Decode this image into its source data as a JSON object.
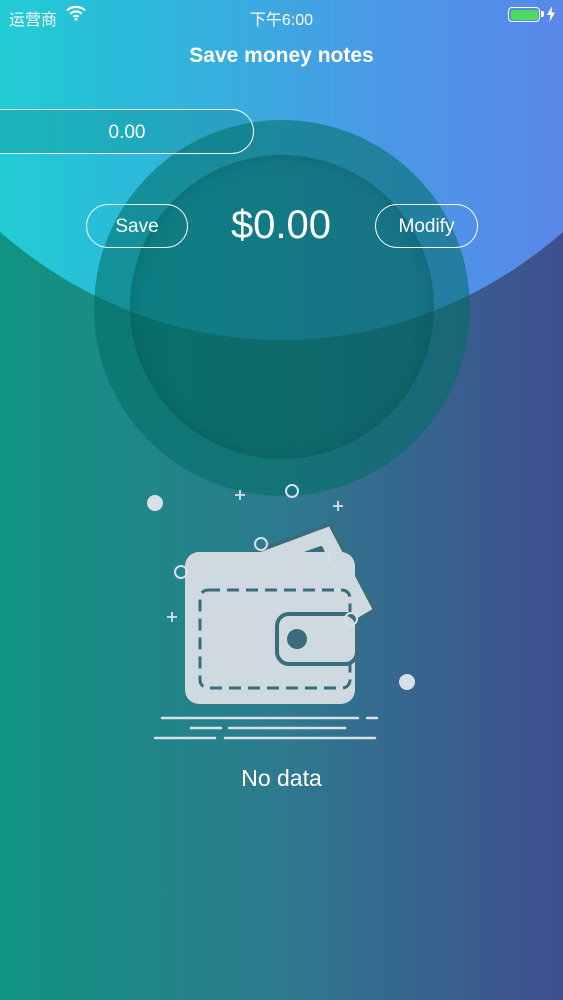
{
  "status_bar": {
    "carrier": "运营商",
    "time": "下午6:00",
    "battery_icon": "battery-full-icon",
    "wifi_icon": "wifi-icon",
    "charging_icon": "charging-bolt-icon"
  },
  "nav": {
    "title": "Save money notes"
  },
  "input": {
    "value": "0.00"
  },
  "actions": {
    "save_label": "Save",
    "modify_label": "Modify"
  },
  "total": {
    "amount": "$0.00"
  },
  "empty_state": {
    "icon": "wallet-icon",
    "message": "No data"
  },
  "colors": {
    "top_gradient_start": "#19e6cf",
    "top_gradient_end": "#6676eb",
    "bottom_gradient_start": "#0f9481",
    "bottom_gradient_end": "#3f4e8f",
    "battery_fill": "#4cd964",
    "text": "#ffffff"
  }
}
